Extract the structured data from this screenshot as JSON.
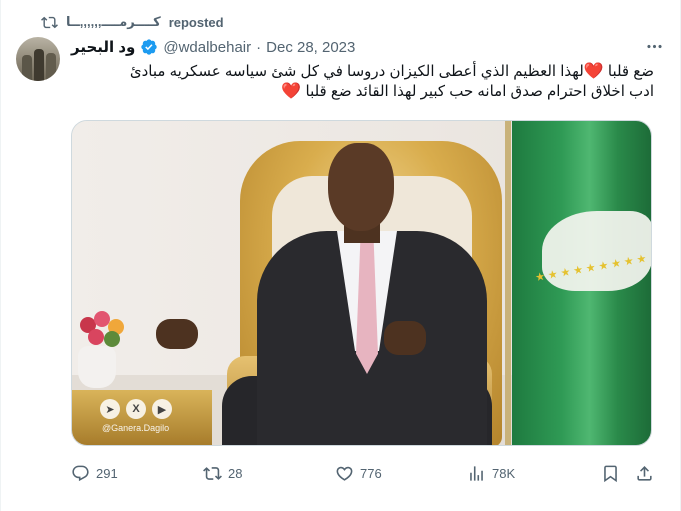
{
  "repost": {
    "name": "كــــرمــــ,,,,,,ــا",
    "label": "reposted"
  },
  "author": {
    "display_name": "ود البحير",
    "handle": "@wdalbehair",
    "separator": "·",
    "date": "Dec 28, 2023",
    "verified": true
  },
  "tweet": {
    "line1": "ضع قلبا ",
    "line1_rest": "لهذا العظيم الذي أعطى الكيزان دروسا في كل شئ سياسه عسكريه مبادئ",
    "line2": "ادب اخلاق احترام صدق امانه حب كبير لهذا القائد ضع قلبا ",
    "heart": "❤️"
  },
  "media": {
    "watermark_text": "@Ganera.Dagilo",
    "watermark_icons": [
      "telegram-icon",
      "x-icon",
      "youtube-icon"
    ]
  },
  "actions": {
    "replies": "291",
    "reposts": "28",
    "likes": "776",
    "views": "78K"
  },
  "colors": {
    "text": "#0f1419",
    "secondary": "#536471",
    "verified": "#1d9bf0",
    "heart": "#e0245e"
  }
}
